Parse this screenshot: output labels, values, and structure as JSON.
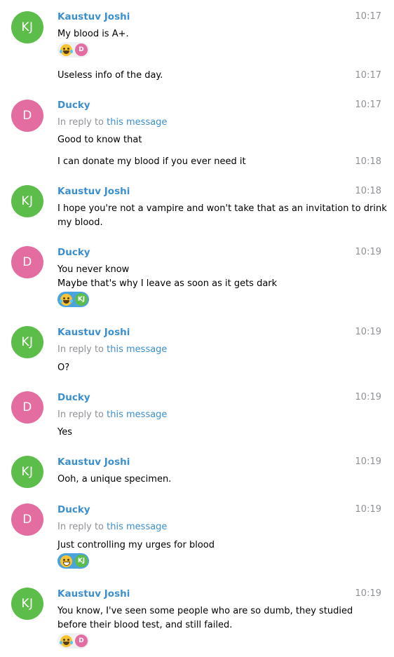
{
  "users": {
    "kaustuv": {
      "name": "Kaustuv Joshi",
      "initials": "KJ"
    },
    "ducky": {
      "name": "Ducky",
      "initials": "D"
    }
  },
  "reply_prefix": "In reply to",
  "reply_link": "this message",
  "messages": [
    {
      "sender": "Kaustuv Joshi",
      "time": "10:17",
      "text": "My blood is A+.",
      "reaction": {
        "emoji": "rolling-on-floor-laughing",
        "reactor": "D"
      }
    },
    {
      "time": "10:17",
      "text": "Useless info of the day."
    },
    {
      "sender": "Ducky",
      "time": "10:17",
      "text": "Good to know that"
    },
    {
      "time": "10:18",
      "text": "I can donate my blood if you ever need it"
    },
    {
      "sender": "Kaustuv Joshi",
      "time": "10:18",
      "text": "I hope you're not a vampire and won't take that as an invitation to drink my blood."
    },
    {
      "sender": "Ducky",
      "time": "10:19",
      "line1": "You never know",
      "line2": "Maybe that's why I leave as soon as it gets dark",
      "reaction": {
        "emoji": "rolling-on-floor-laughing",
        "reactor": "KJ"
      }
    },
    {
      "sender": "Kaustuv Joshi",
      "time": "10:19",
      "text": "O?"
    },
    {
      "sender": "Ducky",
      "time": "10:19",
      "text": "Yes"
    },
    {
      "sender": "Kaustuv Joshi",
      "time": "10:19",
      "text": "Ooh, a unique specimen."
    },
    {
      "sender": "Ducky",
      "time": "10:19",
      "text": "Just controlling my urges for blood",
      "reaction": {
        "emoji": "grinning-face",
        "reactor": "KJ"
      }
    },
    {
      "sender": "Kaustuv Joshi",
      "time": "10:19",
      "text": "You know, I've seen some people who are so dumb, they studied before their blood test, and still failed.",
      "reaction": {
        "emoji": "rolling-on-floor-laughing",
        "reactor": "D"
      }
    }
  ],
  "colors": {
    "kaustuv_avatar": "#5cbd4a",
    "ducky_avatar": "#e36da0",
    "sender_name": "#3b8fcd",
    "timestamp": "#8e9196",
    "reaction_active": "#4aa3dd",
    "reaction_idle": "#eef0f2"
  }
}
